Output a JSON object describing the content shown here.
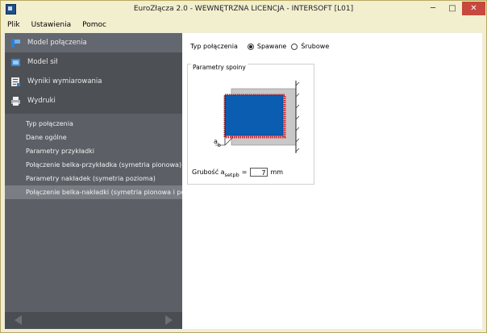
{
  "window": {
    "title": "EuroZłącza 2.0 - WEWNĘTRZNA LICENCJA - INTERSOFT [L01]",
    "min": "─",
    "max": "□",
    "close": "✕"
  },
  "menu": [
    "Plik",
    "Ustawienia",
    "Pomoc"
  ],
  "nav": {
    "items": [
      {
        "label": "Model połączenia",
        "icon": "connection-model-icon"
      },
      {
        "label": "Model sił",
        "icon": "forces-model-icon"
      },
      {
        "label": "Wyniki wymiarowania",
        "icon": "results-icon"
      },
      {
        "label": "Wydruki",
        "icon": "printer-icon"
      }
    ],
    "sub_items": [
      "Typ połączenia",
      "Dane ogólne",
      "Parametry przykładki",
      "Połączenie belka-przykładka (symetria pionowa)",
      "Parametry nakładek (symetria pozioma)",
      "Połączenie belka-nakładki (symetria pionowa i pozioma)"
    ]
  },
  "content": {
    "connection_type_label": "Typ połączenia",
    "option_welded": "Spawane",
    "option_bolted": "Śrubowe",
    "selected_option": "Spawane",
    "group_title": "Parametry spoiny",
    "diagram_label_main": "a",
    "diagram_label_sub": "b",
    "thickness_label_main": "Grubość a",
    "thickness_label_sub": "setpb",
    "thickness_label_eq": "=",
    "thickness_value": "7",
    "thickness_unit": "mm"
  },
  "colors": {
    "plate": "#0a5db0",
    "weld": "#d8202c",
    "beam": "#c8c8c8",
    "sidebar": "#4d5156"
  }
}
